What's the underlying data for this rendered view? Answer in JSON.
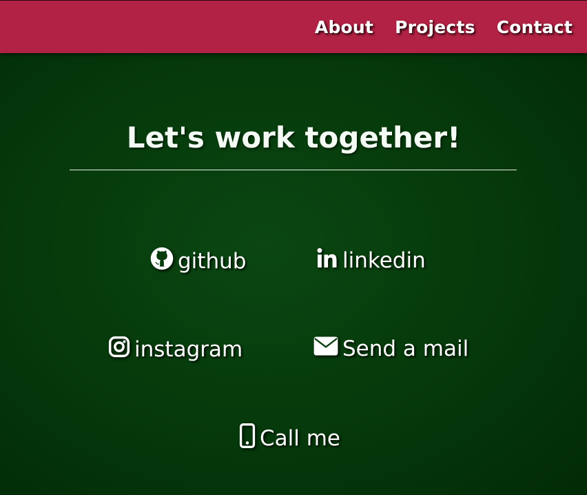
{
  "nav": {
    "links": [
      "About",
      "Projects",
      "Contact"
    ]
  },
  "section": {
    "heading": "Let's work together!"
  },
  "contacts": [
    {
      "icon": "github-icon",
      "label": "github"
    },
    {
      "icon": "linkedin-icon",
      "label": "linkedin"
    },
    {
      "icon": "instagram-icon",
      "label": "instagram"
    },
    {
      "icon": "envelope-icon",
      "label": "Send a mail"
    },
    {
      "icon": "mobile-phone-icon",
      "label": "Call me"
    }
  ],
  "colors": {
    "navbar": "#b22244",
    "background": "#063b0c",
    "text": "#ffffff"
  }
}
